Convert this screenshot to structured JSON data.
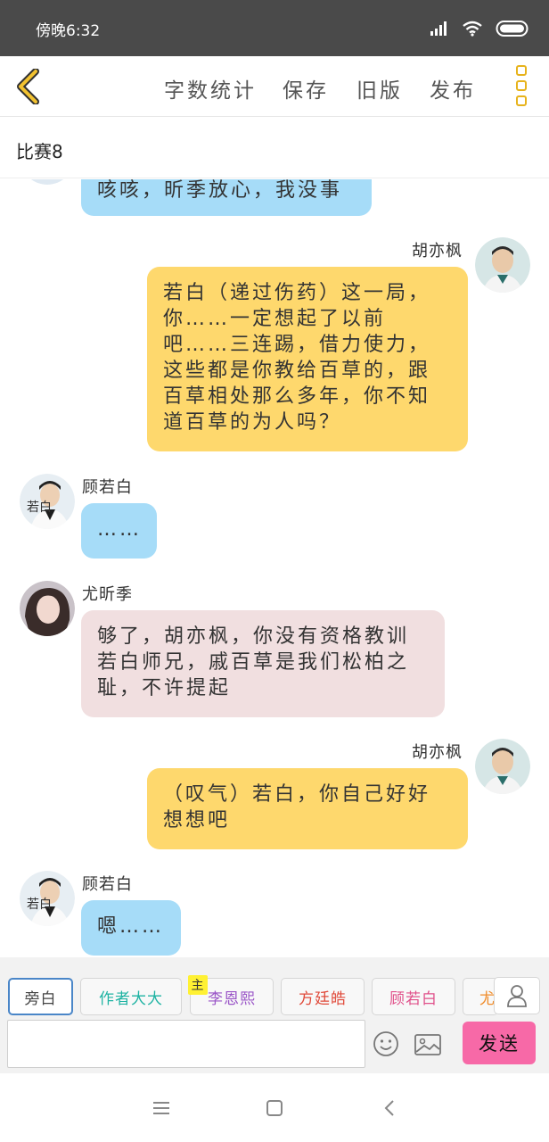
{
  "status_bar": {
    "time": "傍晚6:32"
  },
  "toolbar": {
    "word_count": "字数统计",
    "save": "保存",
    "old_version": "旧版",
    "publish": "发布"
  },
  "title": "比赛8",
  "messages": [
    {
      "side": "left",
      "speaker": "",
      "color": "blue",
      "text": "咳咳，昕季放心，我没事"
    },
    {
      "side": "right",
      "speaker": "胡亦枫",
      "color": "yellow",
      "text": "若白（递过伤药）这一局，你……一定想起了以前吧……三连踢，借力使力，这些都是你教给百草的，跟百草相处那么多年，你不知道百草的为人吗？"
    },
    {
      "side": "left",
      "speaker": "顾若白",
      "color": "blue",
      "text": "……"
    },
    {
      "side": "left",
      "speaker": "尤昕季",
      "color": "pink",
      "text": "够了，胡亦枫，你没有资格教训若白师兄，戚百草是我们松柏之耻，不许提起"
    },
    {
      "side": "right",
      "speaker": "胡亦枫",
      "color": "yellow",
      "text": "（叹气）若白，你自己好好想想吧"
    },
    {
      "side": "left",
      "speaker": "顾若白",
      "color": "blue",
      "text": "嗯……"
    }
  ],
  "characters": [
    {
      "label": "旁白",
      "color": "#444444"
    },
    {
      "label": "作者大大",
      "color": "#1fb3a3"
    },
    {
      "label": "李恩熙",
      "color": "#9a55c7",
      "badge": "主"
    },
    {
      "label": "方廷皓",
      "color": "#e04a3a"
    },
    {
      "label": "顾若白",
      "color": "#e0508a"
    },
    {
      "label": "尤",
      "color": "#f08c2a"
    }
  ],
  "input": {
    "placeholder": "",
    "value": ""
  },
  "send_label": "发送",
  "colors": {
    "accent": "#e7b31c",
    "bubble_blue": "#a6dcf8",
    "bubble_yellow": "#fed86d",
    "bubble_pink": "#f1dfe0",
    "send": "#f769a7"
  }
}
